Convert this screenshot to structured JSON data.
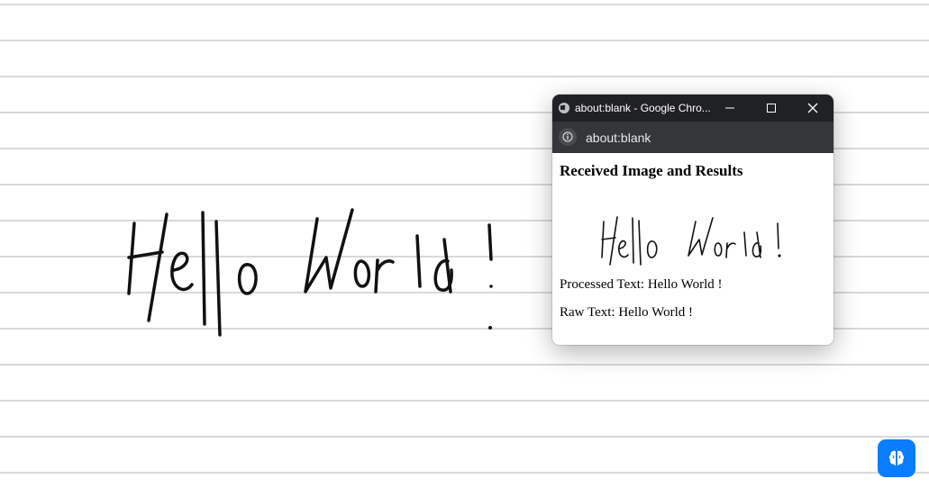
{
  "canvas": {
    "handwriting": "Hello World !",
    "line_color": "#d9d9d9",
    "ink_color": "#111111"
  },
  "popup": {
    "window_title": "about:blank - Google Chro...",
    "url": "about:blank",
    "heading": "Received Image and Results",
    "image_text": "Hello World !",
    "processed_text": "Processed Text: Hello World !",
    "raw_text": "Raw Text: Hello World !",
    "icons": [
      "globe-icon",
      "minimize-icon",
      "maximize-icon",
      "close-icon",
      "info-icon"
    ]
  },
  "fab": {
    "icon": "brain-icon",
    "color": "#0a7cff"
  }
}
